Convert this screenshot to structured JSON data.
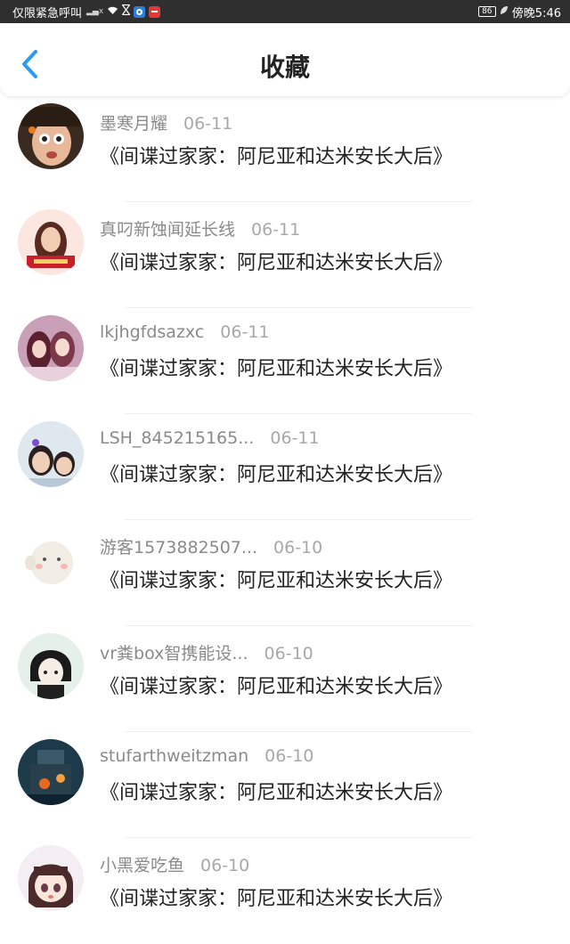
{
  "status_bar": {
    "carrier_text": "仅限紧急呼叫",
    "signal_text": "x",
    "battery": "86",
    "time": "傍晚5:46"
  },
  "header": {
    "title": "收藏",
    "back_icon": "chevron-left-icon",
    "accent_color": "#2b9af3"
  },
  "favorites": [
    {
      "user": "墨寒月耀",
      "date": "06-11",
      "title": "《间谍过家家：阿尼亚和达米安长大后》"
    },
    {
      "user": "真叼新蚀闻延长线",
      "date": "06-11",
      "title": "《间谍过家家：阿尼亚和达米安长大后》"
    },
    {
      "user": "lkjhgfdsazxc",
      "date": "06-11",
      "title": "《间谍过家家：阿尼亚和达米安长大后》"
    },
    {
      "user": "LSH_845215165...",
      "date": "06-11",
      "title": "《间谍过家家：阿尼亚和达米安长大后》"
    },
    {
      "user": "游客1573882507...",
      "date": "06-10",
      "title": "《间谍过家家：阿尼亚和达米安长大后》"
    },
    {
      "user": "vr粪box智携能设...",
      "date": "06-10",
      "title": "《间谍过家家：阿尼亚和达米安长大后》"
    },
    {
      "user": "stufarthweitzman",
      "date": "06-10",
      "title": "《间谍过家家：阿尼亚和达米安长大后》"
    },
    {
      "user": "小黑爱吃鱼",
      "date": "06-10",
      "title": "《间谍过家家：阿尼亚和达米安长大后》"
    }
  ]
}
